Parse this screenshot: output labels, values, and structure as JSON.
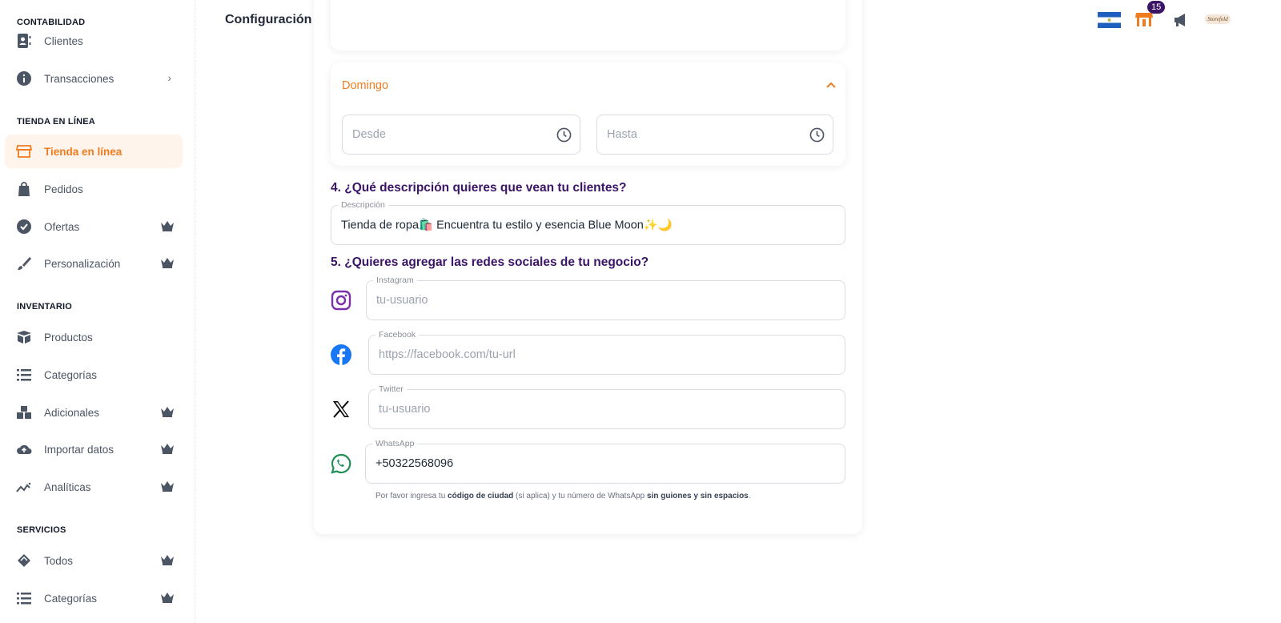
{
  "sidebar": {
    "sections": [
      {
        "title": "CONTABILIDAD",
        "items": [
          {
            "label": "Clientes",
            "icon": "contact-book-icon"
          },
          {
            "label": "Transacciones",
            "icon": "info-icon",
            "chevron": true
          }
        ]
      },
      {
        "title": "TIENDA EN LÍNEA",
        "items": [
          {
            "label": "Tienda en línea",
            "icon": "storefront-icon",
            "active": true
          },
          {
            "label": "Pedidos",
            "icon": "shopping-bag-icon"
          },
          {
            "label": "Ofertas",
            "icon": "badge-check-icon",
            "premium": true
          },
          {
            "label": "Personalización",
            "icon": "brush-icon",
            "premium": true
          }
        ]
      },
      {
        "title": "INVENTARIO",
        "items": [
          {
            "label": "Productos",
            "icon": "box-icon"
          },
          {
            "label": "Categorías",
            "icon": "list-icon"
          },
          {
            "label": "Adicionales",
            "icon": "boxes-icon",
            "premium": true
          },
          {
            "label": "Importar datos",
            "icon": "cloud-upload-icon",
            "premium": true
          },
          {
            "label": "Analíticas",
            "icon": "chart-line-icon",
            "premium": true
          }
        ]
      },
      {
        "title": "SERVICIOS",
        "items": [
          {
            "label": "Todos",
            "icon": "handshake-icon",
            "premium": true
          },
          {
            "label": "Categorías",
            "icon": "list-icon",
            "premium": true
          }
        ]
      }
    ]
  },
  "header": {
    "title": "Configuración de Tienda",
    "notification_count": "15",
    "accent": "#f07c20",
    "badge_color": "#3b1466"
  },
  "form": {
    "day": {
      "name": "Domingo",
      "from_placeholder": "Desde",
      "to_placeholder": "Hasta"
    },
    "q4": "4. ¿Qué descripción quieres que vean tu clientes?",
    "description": {
      "label": "Descripción",
      "value": "Tienda de ropa🛍️ Encuentra tu estilo y esencia Blue Moon✨🌙"
    },
    "q5": "5. ¿Quieres agregar las redes sociales de tu negocio?",
    "social": [
      {
        "label": "Instagram",
        "placeholder": "tu-usuario",
        "value": "",
        "icon": "instagram-icon"
      },
      {
        "label": "Facebook",
        "placeholder": "https://facebook.com/tu-url",
        "value": "",
        "icon": "facebook-icon"
      },
      {
        "label": "Twitter",
        "placeholder": "tu-usuario",
        "value": "",
        "icon": "x-twitter-icon"
      },
      {
        "label": "WhatsApp",
        "placeholder": "",
        "value": "+50322568096",
        "icon": "whatsapp-icon"
      }
    ],
    "help": {
      "p1": "Por favor ingresa tu ",
      "b1": "código de ciudad",
      "p2": " (si aplica) y tu número de WhatsApp ",
      "b2": "sin guiones y sin espacios",
      "p3": "."
    }
  }
}
